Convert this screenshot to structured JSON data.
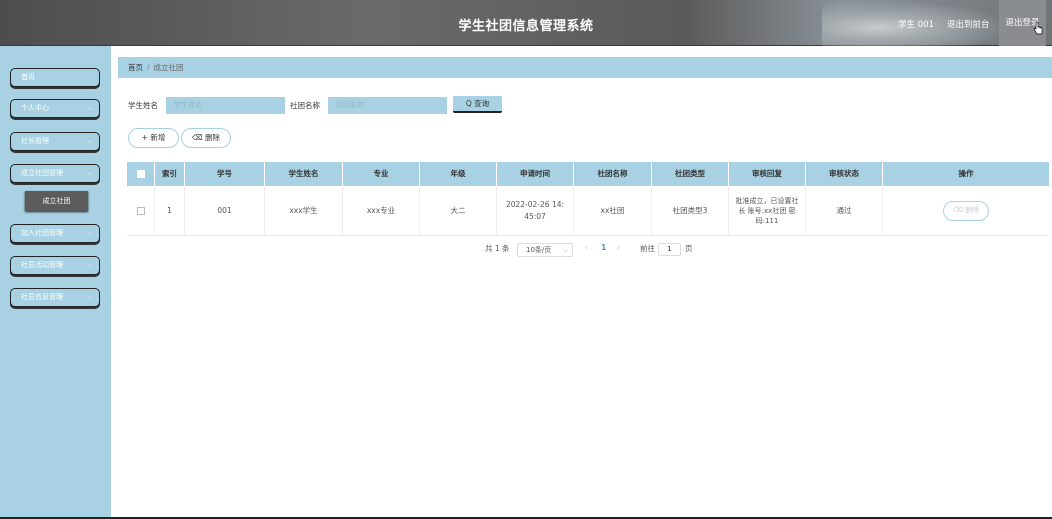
{
  "header": {
    "title": "学生社团信息管理系统",
    "user": "学生 001",
    "backend": "退出到前台",
    "logout": "退出登录"
  },
  "sidebar": {
    "items": [
      {
        "label": "首页",
        "chevron": ""
      },
      {
        "label": "个人中心",
        "chevron": "⌵"
      },
      {
        "label": "社长管理",
        "chevron": "⌵"
      },
      {
        "label": "成立社团管理",
        "chevron": "⌵"
      },
      {
        "label": "加入社团管理",
        "chevron": "⌵"
      },
      {
        "label": "社员活动管理",
        "chevron": "⌵"
      },
      {
        "label": "社员信息管理",
        "chevron": "⌵"
      }
    ],
    "submenu": "成立社团"
  },
  "breadcrumb": {
    "home": "首页",
    "sep": "/",
    "current": "成立社团"
  },
  "search": {
    "student_name_label": "学生姓名",
    "student_name_placeholder": "学生姓名",
    "club_name_label": "社团名称",
    "club_name_placeholder": "社团名称",
    "search_button": "Q 查询"
  },
  "actions": {
    "add": "+ 新增",
    "delete": "⌫ 删除"
  },
  "table": {
    "headers": [
      "",
      "索引",
      "学号",
      "学生姓名",
      "专业",
      "年级",
      "申请时间",
      "社团名称",
      "社团类型",
      "审核回复",
      "审核状态",
      "操作"
    ],
    "rows": [
      {
        "index": "1",
        "student_id": "001",
        "student_name": "xxx学生",
        "major": "xxx专业",
        "grade": "大二",
        "apply_time": "2022-02-26 14:45:07",
        "club_name": "xx社团",
        "club_type": "社团类型3",
        "review_reply": "批准成立，已设置社长 账号:xx社团 密码:111",
        "review_status": "通过",
        "op_delete": "⌫ 删除"
      }
    ]
  },
  "pagination": {
    "total": "共 1 条",
    "page_size": "10条/页",
    "prev": "‹",
    "current": "1",
    "next": "›",
    "goto_label": "前往",
    "goto_value": "1",
    "page_unit": "页"
  }
}
